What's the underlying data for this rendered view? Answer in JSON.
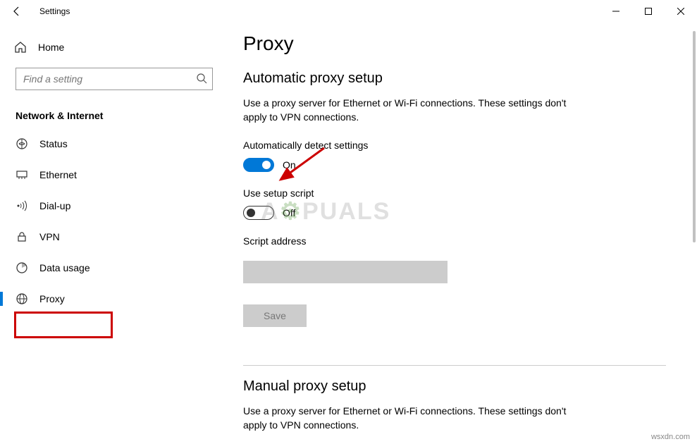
{
  "titlebar": {
    "app_title": "Settings"
  },
  "sidebar": {
    "home_label": "Home",
    "search_placeholder": "Find a setting",
    "category_header": "Network & Internet",
    "items": [
      {
        "label": "Status"
      },
      {
        "label": "Ethernet"
      },
      {
        "label": "Dial-up"
      },
      {
        "label": "VPN"
      },
      {
        "label": "Data usage"
      },
      {
        "label": "Proxy"
      }
    ]
  },
  "content": {
    "page_title": "Proxy",
    "auto_heading": "Automatic proxy setup",
    "auto_desc": "Use a proxy server for Ethernet or Wi-Fi connections. These settings don't apply to VPN connections.",
    "auto_detect_label": "Automatically detect settings",
    "auto_detect_state": "On",
    "setup_script_label": "Use setup script",
    "setup_script_state": "Off",
    "script_address_label": "Script address",
    "save_label": "Save",
    "manual_heading": "Manual proxy setup",
    "manual_desc": "Use a proxy server for Ethernet or Wi-Fi connections. These settings don't apply to VPN connections."
  },
  "footer_watermark": "wsxdn.com"
}
